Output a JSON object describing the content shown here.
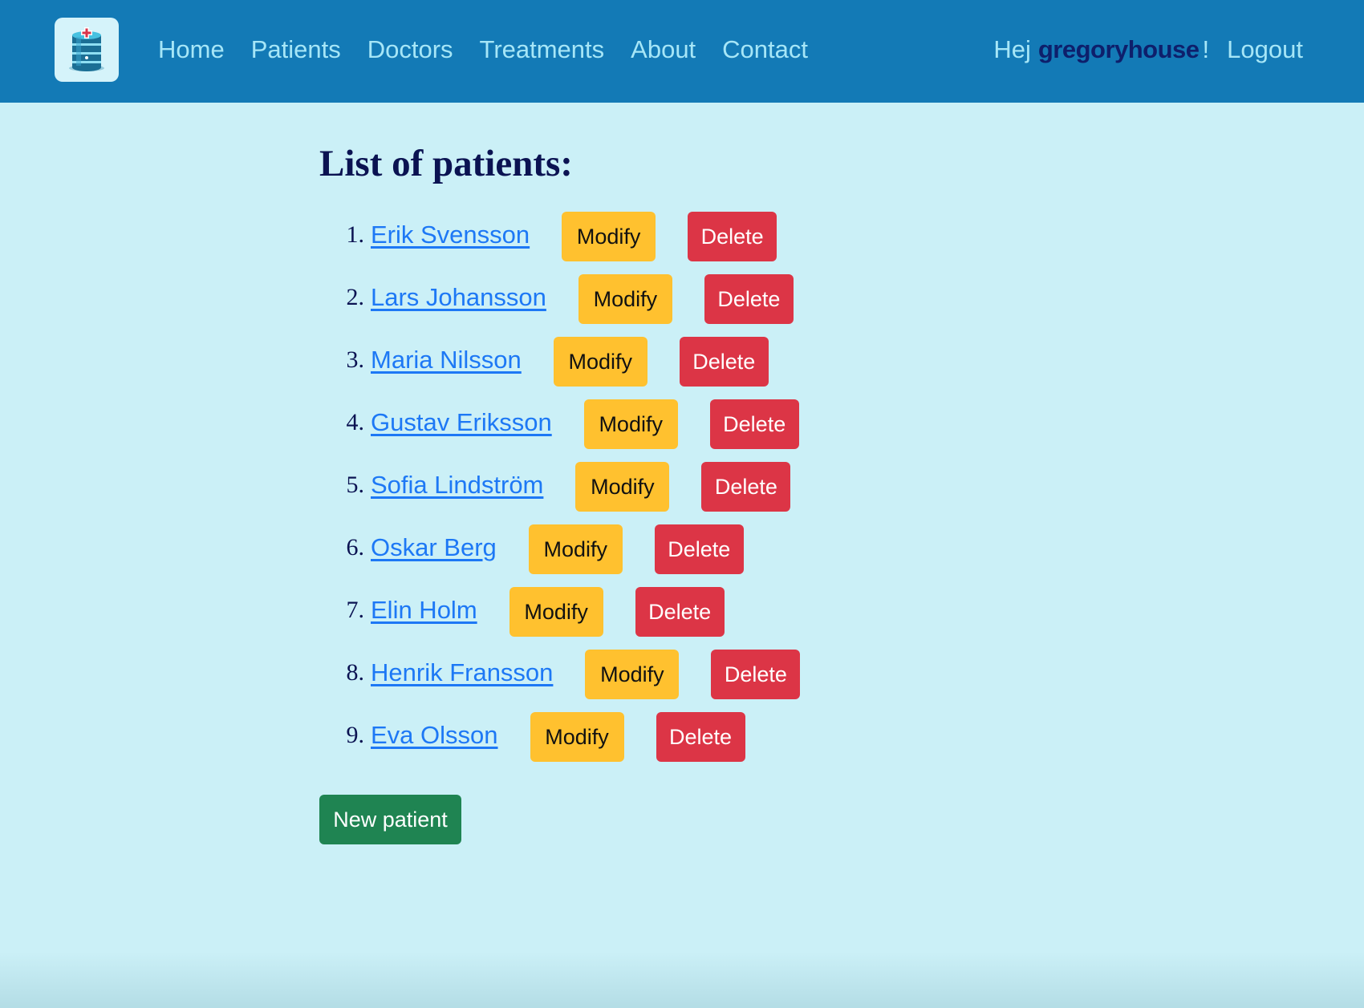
{
  "nav": {
    "logo_icon": "hospital-database-logo-icon",
    "links": [
      {
        "label": "Home"
      },
      {
        "label": "Patients"
      },
      {
        "label": "Doctors"
      },
      {
        "label": "Treatments"
      },
      {
        "label": "About"
      },
      {
        "label": "Contact"
      }
    ],
    "greeting": "Hej",
    "username": "gregoryhouse",
    "exclamation": "!",
    "logout_label": "Logout"
  },
  "main": {
    "title": "List of patients:",
    "patients": [
      {
        "number": "1.",
        "name": "Erik Svensson",
        "modify_label": "Modify",
        "delete_label": "Delete"
      },
      {
        "number": "2.",
        "name": "Lars Johansson",
        "modify_label": "Modify",
        "delete_label": "Delete"
      },
      {
        "number": "3.",
        "name": "Maria Nilsson",
        "modify_label": "Modify",
        "delete_label": "Delete"
      },
      {
        "number": "4.",
        "name": "Gustav Eriksson",
        "modify_label": "Modify",
        "delete_label": "Delete"
      },
      {
        "number": "5.",
        "name": "Sofia Lindström",
        "modify_label": "Modify",
        "delete_label": "Delete"
      },
      {
        "number": "6.",
        "name": "Oskar Berg",
        "modify_label": "Modify",
        "delete_label": "Delete"
      },
      {
        "number": "7.",
        "name": "Elin Holm",
        "modify_label": "Modify",
        "delete_label": "Delete"
      },
      {
        "number": "8.",
        "name": "Henrik Fransson",
        "modify_label": "Modify",
        "delete_label": "Delete"
      },
      {
        "number": "9.",
        "name": "Eva Olsson",
        "modify_label": "Modify",
        "delete_label": "Delete"
      }
    ],
    "new_patient_label": "New patient"
  },
  "colors": {
    "navbar": "#137ab6",
    "nav_link": "#a6e6f7",
    "background": "#cbf0f7",
    "title": "#0b1352",
    "link": "#1d78f5",
    "modify": "#ffc12f",
    "delete": "#dc3546",
    "new": "#1f8452"
  }
}
